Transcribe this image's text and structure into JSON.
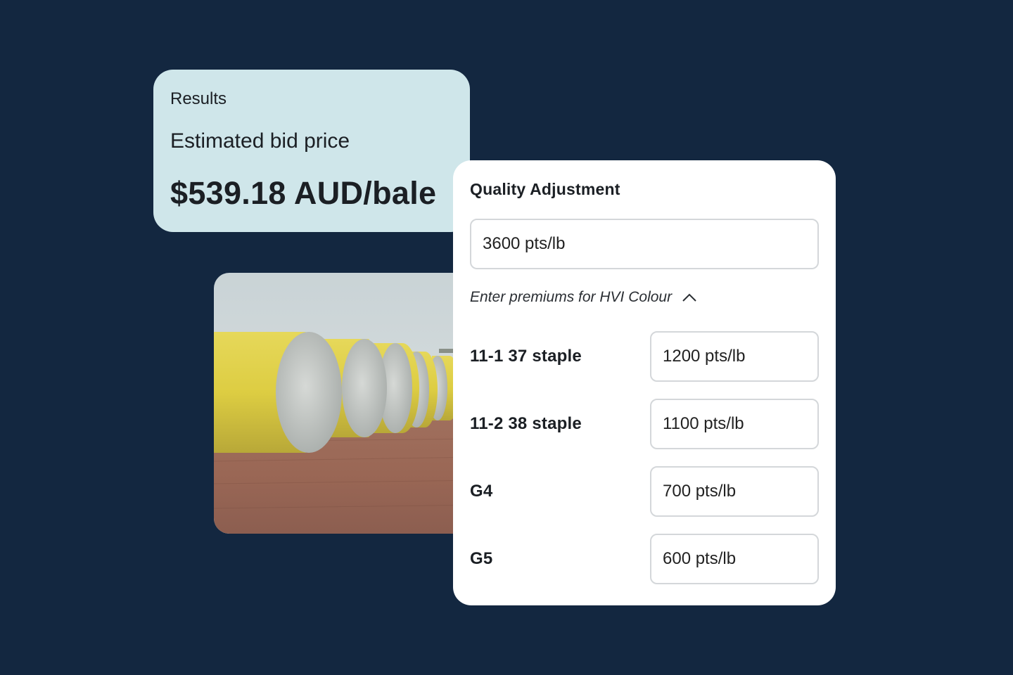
{
  "results": {
    "label": "Results",
    "subtitle": "Estimated bid price",
    "price": "$539.18 AUD/bale"
  },
  "photo": {
    "icon": "cotton-bales-photo"
  },
  "quality": {
    "title": "Quality Adjustment",
    "total_value": "3600 pts/lb",
    "toggle_label": "Enter premiums for HVI Colour",
    "toggle_icon": "chevron-up-icon",
    "grades": [
      {
        "label": "11-1 37 staple",
        "value": "1200 pts/lb"
      },
      {
        "label": "11-2 38 staple",
        "value": "1100 pts/lb"
      },
      {
        "label": "G4",
        "value": "700 pts/lb"
      },
      {
        "label": "G5",
        "value": "600 pts/lb"
      }
    ]
  },
  "colors": {
    "background": "#132740",
    "results_card": "#cfe6ea",
    "quality_card": "#ffffff"
  }
}
